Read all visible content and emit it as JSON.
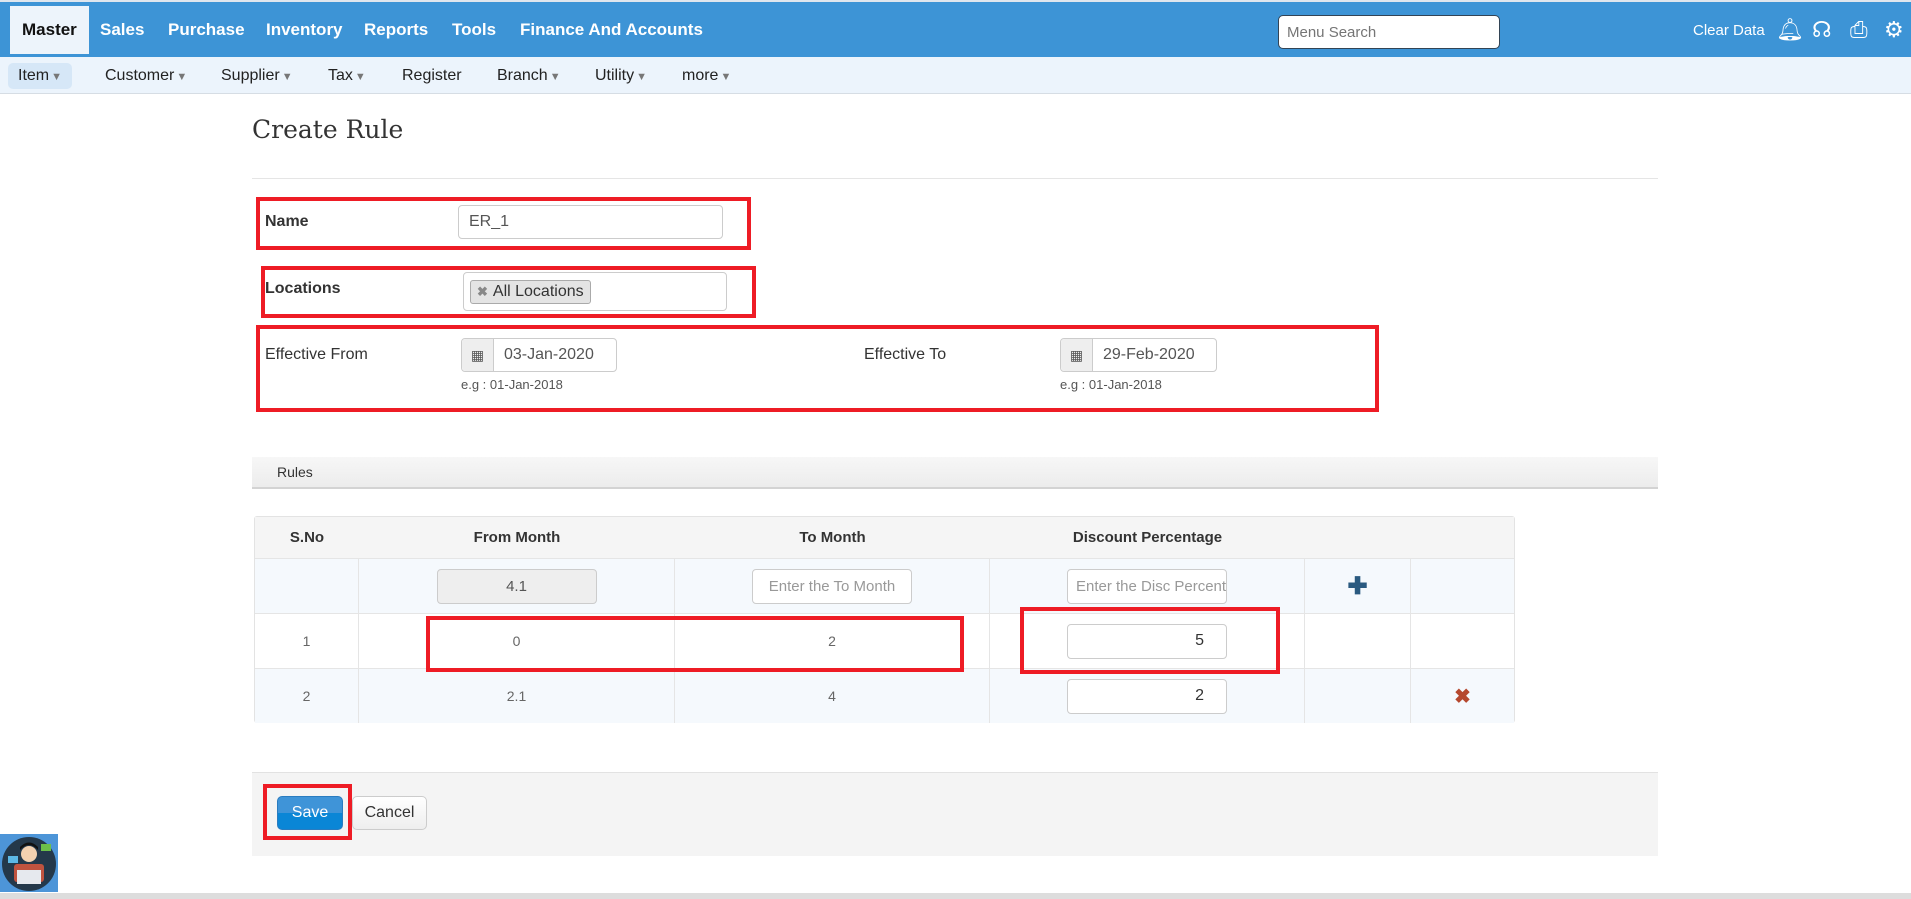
{
  "topnav": {
    "items": [
      "Master",
      "Sales",
      "Purchase",
      "Inventory",
      "Reports",
      "Tools",
      "Finance And Accounts"
    ],
    "search_placeholder": "Menu Search",
    "clear_data": "Clear Data"
  },
  "subnav": {
    "items": [
      {
        "label": "Item",
        "caret": "▼"
      },
      {
        "label": "Customer",
        "caret": "▼"
      },
      {
        "label": "Supplier",
        "caret": "▼"
      },
      {
        "label": "Tax",
        "caret": "▼"
      },
      {
        "label": "Register",
        "caret": ""
      },
      {
        "label": "Branch",
        "caret": "▼"
      },
      {
        "label": "Utility",
        "caret": "▼"
      },
      {
        "label": "more",
        "caret": "▼"
      }
    ]
  },
  "page": {
    "title": "Create Rule",
    "name_label": "Name",
    "name_value": "ER_1",
    "locations_label": "Locations",
    "location_tag": "All Locations",
    "effective_from_label": "Effective From",
    "effective_from_value": "03-Jan-2020",
    "effective_to_label": "Effective To",
    "effective_to_value": "29-Feb-2020",
    "date_hint": "e.g : 01-Jan-2018"
  },
  "rules": {
    "section_title": "Rules",
    "headers": [
      "S.No",
      "From Month",
      "To Month",
      "Discount Percentage"
    ],
    "entry": {
      "from_value": "4.1",
      "to_placeholder": "Enter the To Month",
      "disc_placeholder": "Enter the Disc Percentage"
    },
    "rows": [
      {
        "sno": "1",
        "from": "0",
        "to": "2",
        "discount": "5"
      },
      {
        "sno": "2",
        "from": "2.1",
        "to": "4",
        "discount": "2"
      }
    ]
  },
  "footer": {
    "save": "Save",
    "cancel": "Cancel"
  },
  "colors": {
    "topbar": "#3d94d6",
    "annotation": "#ee1c25",
    "save": "#0a86d6"
  }
}
